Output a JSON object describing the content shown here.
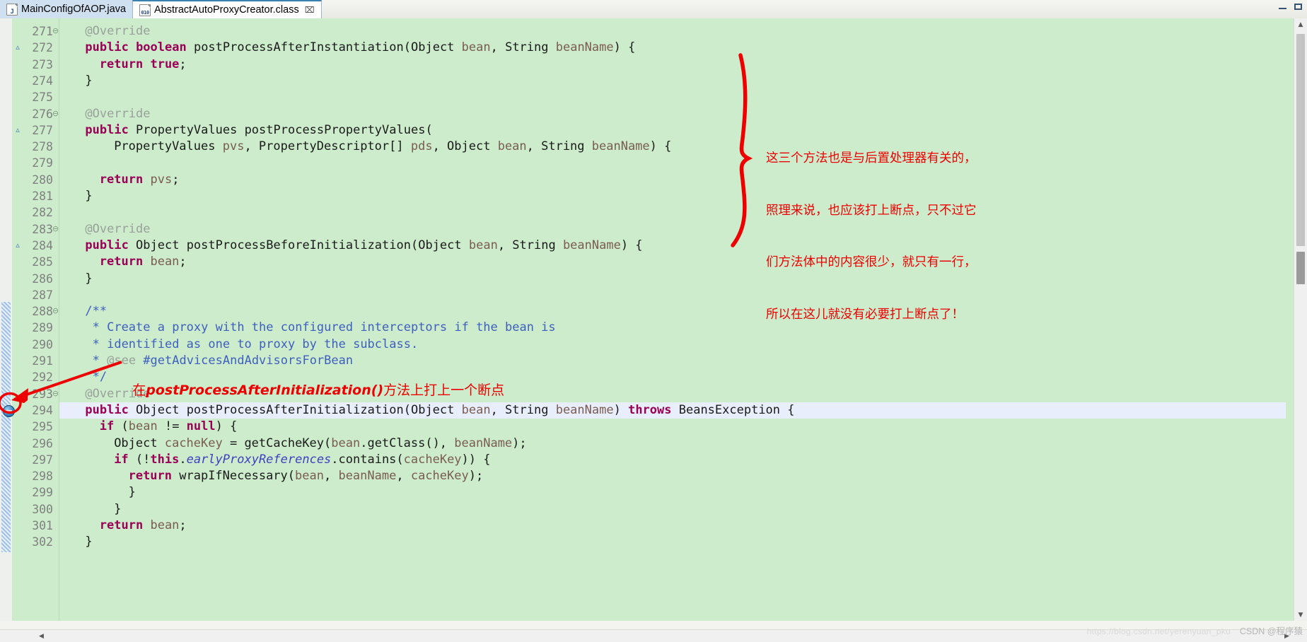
{
  "window": {
    "minimize_label": "minimize",
    "maximize_label": "maximize"
  },
  "tabs": [
    {
      "label": "MainConfigOfAOP.java",
      "icon": "java-file-icon",
      "active": false,
      "closable": false,
      "icon_glyph": "J"
    },
    {
      "label": "AbstractAutoProxyCreator.class",
      "icon": "class-file-icon",
      "active": true,
      "closable": true,
      "close_glyph": "⌧",
      "icon_glyph": "010"
    }
  ],
  "editor": {
    "background_color": "#cceccc",
    "current_line_color": "#e8eefb",
    "first_line": 271,
    "lines": [
      {
        "n": 271,
        "fold": "⊖",
        "indent": 1,
        "tokens": [
          {
            "t": "@Override",
            "c": "ann"
          }
        ]
      },
      {
        "n": 272,
        "override": "▵",
        "indent": 1,
        "tokens": [
          {
            "t": "public",
            "c": "kw"
          },
          {
            "t": " "
          },
          {
            "t": "boolean",
            "c": "kw"
          },
          {
            "t": " postProcessAfterInstantiation(Object "
          },
          {
            "t": "bean",
            "c": "param"
          },
          {
            "t": ", String "
          },
          {
            "t": "beanName",
            "c": "param"
          },
          {
            "t": ") {"
          }
        ]
      },
      {
        "n": 273,
        "indent": 2,
        "tokens": [
          {
            "t": "return",
            "c": "kw"
          },
          {
            "t": " "
          },
          {
            "t": "true",
            "c": "kw"
          },
          {
            "t": ";"
          }
        ]
      },
      {
        "n": 274,
        "indent": 1,
        "tokens": [
          {
            "t": "}"
          }
        ]
      },
      {
        "n": 275,
        "indent": 0,
        "tokens": []
      },
      {
        "n": 276,
        "fold": "⊖",
        "indent": 1,
        "tokens": [
          {
            "t": "@Override",
            "c": "ann"
          }
        ]
      },
      {
        "n": 277,
        "override": "▵",
        "indent": 1,
        "tokens": [
          {
            "t": "public",
            "c": "kw"
          },
          {
            "t": " PropertyValues postProcessPropertyValues("
          }
        ]
      },
      {
        "n": 278,
        "indent": 3,
        "tokens": [
          {
            "t": "PropertyValues "
          },
          {
            "t": "pvs",
            "c": "param"
          },
          {
            "t": ", PropertyDescriptor[] "
          },
          {
            "t": "pds",
            "c": "param"
          },
          {
            "t": ", Object "
          },
          {
            "t": "bean",
            "c": "param"
          },
          {
            "t": ", String "
          },
          {
            "t": "beanName",
            "c": "param"
          },
          {
            "t": ") {"
          }
        ]
      },
      {
        "n": 279,
        "indent": 0,
        "tokens": []
      },
      {
        "n": 280,
        "indent": 2,
        "tokens": [
          {
            "t": "return",
            "c": "kw"
          },
          {
            "t": " "
          },
          {
            "t": "pvs",
            "c": "param"
          },
          {
            "t": ";"
          }
        ]
      },
      {
        "n": 281,
        "indent": 1,
        "tokens": [
          {
            "t": "}"
          }
        ]
      },
      {
        "n": 282,
        "indent": 0,
        "tokens": []
      },
      {
        "n": 283,
        "fold": "⊖",
        "indent": 1,
        "tokens": [
          {
            "t": "@Override",
            "c": "ann"
          }
        ]
      },
      {
        "n": 284,
        "override": "▵",
        "indent": 1,
        "tokens": [
          {
            "t": "public",
            "c": "kw"
          },
          {
            "t": " Object postProcessBeforeInitialization(Object "
          },
          {
            "t": "bean",
            "c": "param"
          },
          {
            "t": ", String "
          },
          {
            "t": "beanName",
            "c": "param"
          },
          {
            "t": ") {"
          }
        ]
      },
      {
        "n": 285,
        "indent": 2,
        "tokens": [
          {
            "t": "return",
            "c": "kw"
          },
          {
            "t": " "
          },
          {
            "t": "bean",
            "c": "param"
          },
          {
            "t": ";"
          }
        ]
      },
      {
        "n": 286,
        "indent": 1,
        "tokens": [
          {
            "t": "}"
          }
        ]
      },
      {
        "n": 287,
        "indent": 0,
        "tokens": []
      },
      {
        "n": 288,
        "fold": "⊖",
        "indent": 1,
        "changed": true,
        "tokens": [
          {
            "t": "/**",
            "c": "cm"
          }
        ]
      },
      {
        "n": 289,
        "indent": 1,
        "changed": true,
        "tokens": [
          {
            "t": " * Create a proxy with the configured interceptors if the bean is",
            "c": "cm"
          }
        ]
      },
      {
        "n": 290,
        "indent": 1,
        "changed": true,
        "tokens": [
          {
            "t": " * identified as one to proxy by the subclass.",
            "c": "cm"
          }
        ]
      },
      {
        "n": 291,
        "indent": 1,
        "changed": true,
        "tokens": [
          {
            "t": " * ",
            "c": "cm"
          },
          {
            "t": "@see",
            "c": "cmtag"
          },
          {
            "t": " #getAdvicesAndAdvisorsForBean",
            "c": "cm"
          }
        ]
      },
      {
        "n": 292,
        "indent": 1,
        "changed": true,
        "tokens": [
          {
            "t": " */",
            "c": "cm"
          }
        ]
      },
      {
        "n": 293,
        "fold": "⊖",
        "indent": 1,
        "changed": true,
        "tokens": [
          {
            "t": "@Override",
            "c": "ann"
          }
        ]
      },
      {
        "n": 294,
        "indent": 1,
        "changed": true,
        "breakpoint": true,
        "current": true,
        "tokens": [
          {
            "t": "public",
            "c": "kw"
          },
          {
            "t": " Object postProcessAfterInitialization(Object "
          },
          {
            "t": "bean",
            "c": "param"
          },
          {
            "t": ", String "
          },
          {
            "t": "beanName",
            "c": "param"
          },
          {
            "t": ") "
          },
          {
            "t": "throws",
            "c": "kw"
          },
          {
            "t": " BeansException {"
          }
        ]
      },
      {
        "n": 295,
        "indent": 2,
        "changed": true,
        "tokens": [
          {
            "t": "if",
            "c": "kw"
          },
          {
            "t": " ("
          },
          {
            "t": "bean",
            "c": "param"
          },
          {
            "t": " != "
          },
          {
            "t": "null",
            "c": "kw"
          },
          {
            "t": ") {"
          }
        ]
      },
      {
        "n": 296,
        "indent": 3,
        "changed": true,
        "tokens": [
          {
            "t": "Object "
          },
          {
            "t": "cacheKey",
            "c": "param"
          },
          {
            "t": " = getCacheKey("
          },
          {
            "t": "bean",
            "c": "param"
          },
          {
            "t": ".getClass(), "
          },
          {
            "t": "beanName",
            "c": "param"
          },
          {
            "t": ");"
          }
        ]
      },
      {
        "n": 297,
        "indent": 3,
        "changed": true,
        "tokens": [
          {
            "t": "if",
            "c": "kw"
          },
          {
            "t": " (!"
          },
          {
            "t": "this",
            "c": "kw"
          },
          {
            "t": "."
          },
          {
            "t": "earlyProxyReferences",
            "c": "field"
          },
          {
            "t": ".contains("
          },
          {
            "t": "cacheKey",
            "c": "param"
          },
          {
            "t": ")) {"
          }
        ]
      },
      {
        "n": 298,
        "indent": 4,
        "changed": true,
        "tokens": [
          {
            "t": "return",
            "c": "kw"
          },
          {
            "t": " wrapIfNecessary("
          },
          {
            "t": "bean",
            "c": "param"
          },
          {
            "t": ", "
          },
          {
            "t": "beanName",
            "c": "param"
          },
          {
            "t": ", "
          },
          {
            "t": "cacheKey",
            "c": "param"
          },
          {
            "t": ");"
          }
        ]
      },
      {
        "n": 299,
        "indent": 4,
        "changed": true,
        "tokens": [
          {
            "t": "}"
          }
        ]
      },
      {
        "n": 300,
        "indent": 3,
        "changed": true,
        "tokens": [
          {
            "t": "}"
          }
        ]
      },
      {
        "n": 301,
        "indent": 2,
        "changed": true,
        "tokens": [
          {
            "t": "return",
            "c": "kw"
          },
          {
            "t": " "
          },
          {
            "t": "bean",
            "c": "param"
          },
          {
            "t": ";"
          }
        ]
      },
      {
        "n": 302,
        "indent": 1,
        "changed": true,
        "tokens": [
          {
            "t": "}"
          }
        ]
      }
    ]
  },
  "annotations": {
    "color": "#ee0000",
    "brace_note": {
      "name": "three-methods-note",
      "lines": [
        "这三个方法也是与后置处理器有关的，",
        "照理来说，也应该打上断点，只不过它",
        "们方法体中的内容很少，就只有一行，",
        "所以在这儿就没有必要打上断点了！"
      ]
    },
    "breakpoint_note": {
      "name": "set-breakpoint-note",
      "prefix": "在",
      "method": "postProcessAfterInitialization()",
      "suffix": "方法上打上一个断点"
    }
  },
  "scrollbars": {
    "vertical": {
      "up_glyph": "▲",
      "down_glyph": "▼"
    },
    "horizontal": {
      "left_glyph": "◀",
      "right_glyph": "▶"
    }
  },
  "watermarks": {
    "url": "https://blog.csdn.net/yerenyuan_pku",
    "brand": "CSDN @程序猿"
  }
}
